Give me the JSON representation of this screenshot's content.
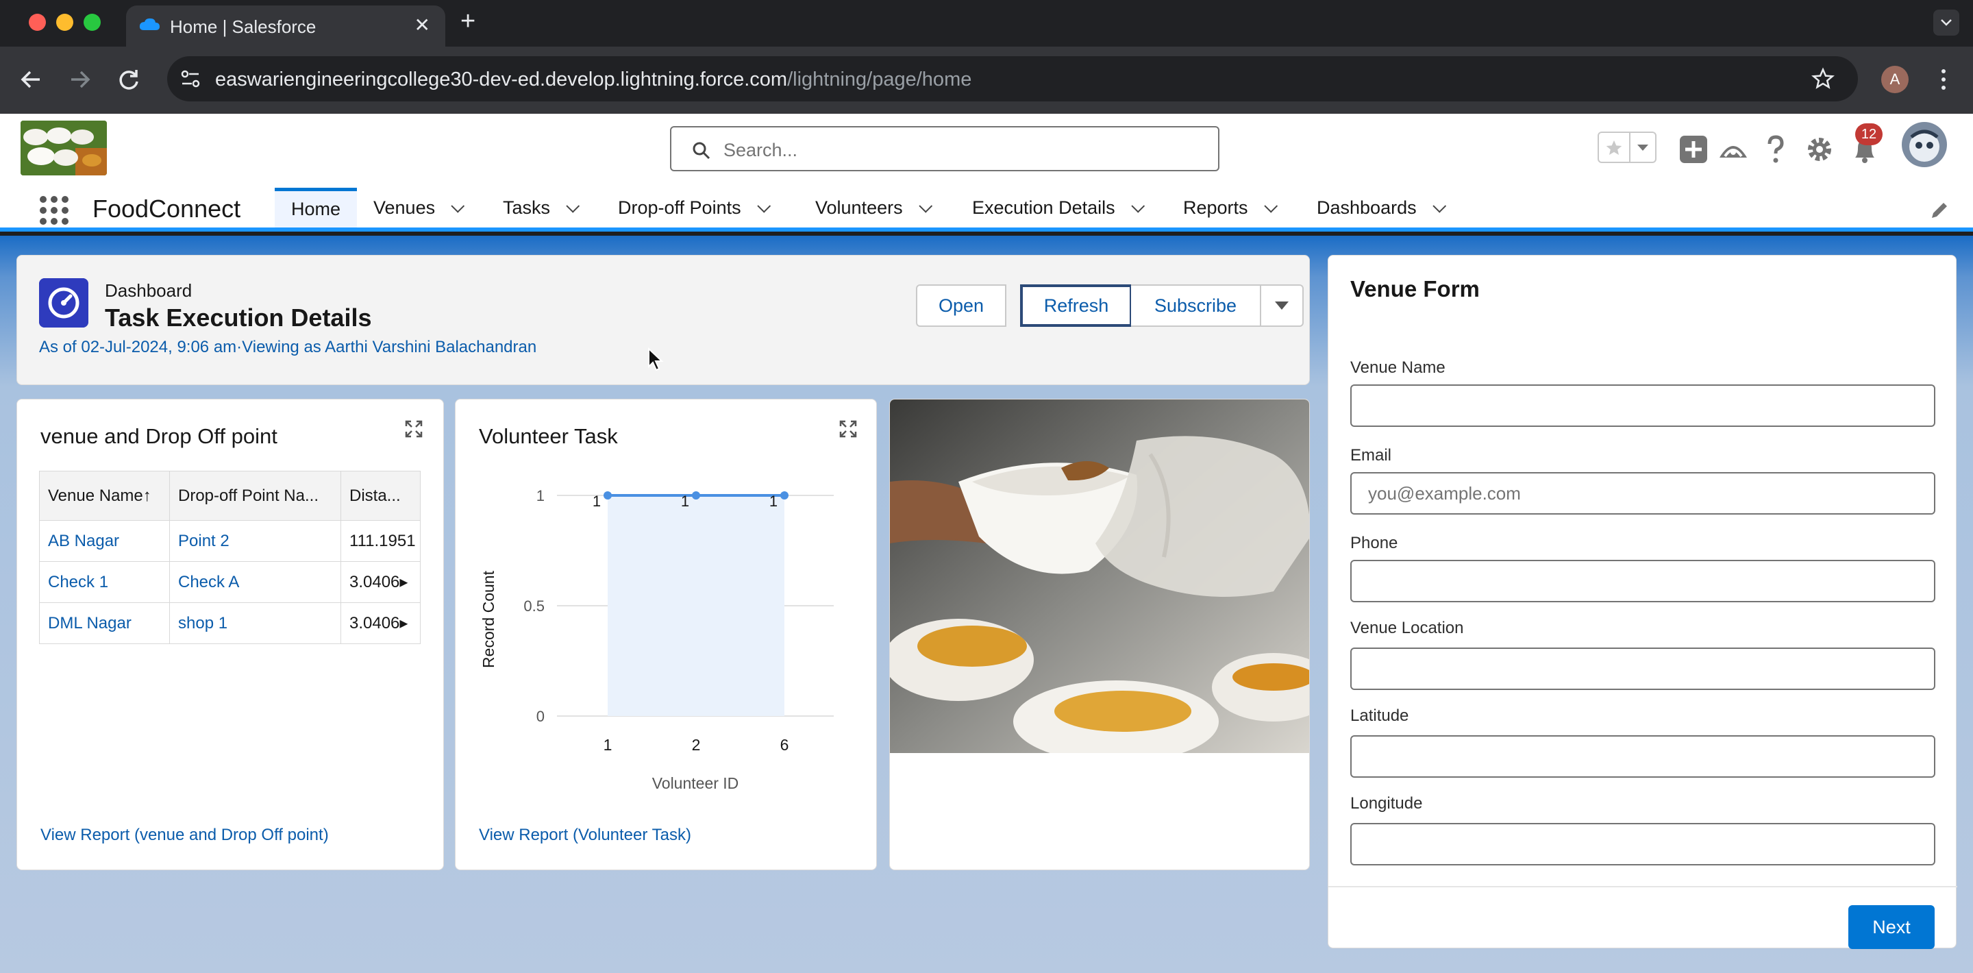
{
  "browser": {
    "tab_title": "Home | Salesforce",
    "url_host": "easwariengineeringcollege30-dev-ed.develop.lightning.force.com",
    "url_path": "/lightning/page/home",
    "profile_initial": "A"
  },
  "header": {
    "search_placeholder": "Search...",
    "notification_count": "12"
  },
  "nav": {
    "app_name": "FoodConnect",
    "items": [
      {
        "label": "Home"
      },
      {
        "label": "Venues"
      },
      {
        "label": "Tasks"
      },
      {
        "label": "Drop-off Points"
      },
      {
        "label": "Volunteers"
      },
      {
        "label": "Execution Details"
      },
      {
        "label": "Reports"
      },
      {
        "label": "Dashboards"
      }
    ]
  },
  "dashboard": {
    "label": "Dashboard",
    "title": "Task Execution Details",
    "meta": "As of 02-Jul-2024, 9:06 am·Viewing as Aarthi Varshini Balachandran",
    "buttons": {
      "open": "Open",
      "refresh": "Refresh",
      "subscribe": "Subscribe"
    }
  },
  "widget_table": {
    "title": "venue and Drop Off point",
    "columns": [
      "Venue Name↑",
      "Drop-off Point Na...",
      "Dista..."
    ],
    "rows": [
      [
        "AB Nagar",
        "Point 2",
        "111.1951"
      ],
      [
        "Check 1",
        "Check A",
        "3.0406▸"
      ],
      [
        "DML Nagar",
        "shop 1",
        "3.0406▸"
      ]
    ],
    "link": "View Report (venue and Drop Off point)"
  },
  "widget_chart": {
    "title": "Volunteer Task",
    "link": "View Report (Volunteer Task)"
  },
  "chart_data": {
    "type": "area",
    "title": "Volunteer Task",
    "xlabel": "Volunteer ID",
    "ylabel": "Record Count",
    "categories": [
      "1",
      "2",
      "6"
    ],
    "values": [
      1,
      1,
      1
    ],
    "data_labels": [
      "1",
      "1",
      "1"
    ],
    "ylim": [
      0,
      1
    ],
    "yticks": [
      "0",
      "0.5",
      "1"
    ],
    "grid": true,
    "color": "#4a90e2",
    "fill": "#eaf2fc"
  },
  "venue_form": {
    "title": "Venue Form",
    "fields": [
      {
        "label": "Venue Name",
        "value": "",
        "placeholder": ""
      },
      {
        "label": "Email",
        "value": "",
        "placeholder": "you@example.com"
      },
      {
        "label": "Phone",
        "value": "",
        "placeholder": ""
      },
      {
        "label": "Venue Location",
        "value": "",
        "placeholder": ""
      },
      {
        "label": "Latitude",
        "value": "",
        "placeholder": ""
      },
      {
        "label": "Longitude",
        "value": "",
        "placeholder": ""
      }
    ],
    "next_label": "Next"
  },
  "colors": {
    "brand_blue": "#0176d3",
    "link_blue": "#0b5cab",
    "dashboard_icon": "#2e3bbd",
    "notification_red": "#c23934"
  }
}
